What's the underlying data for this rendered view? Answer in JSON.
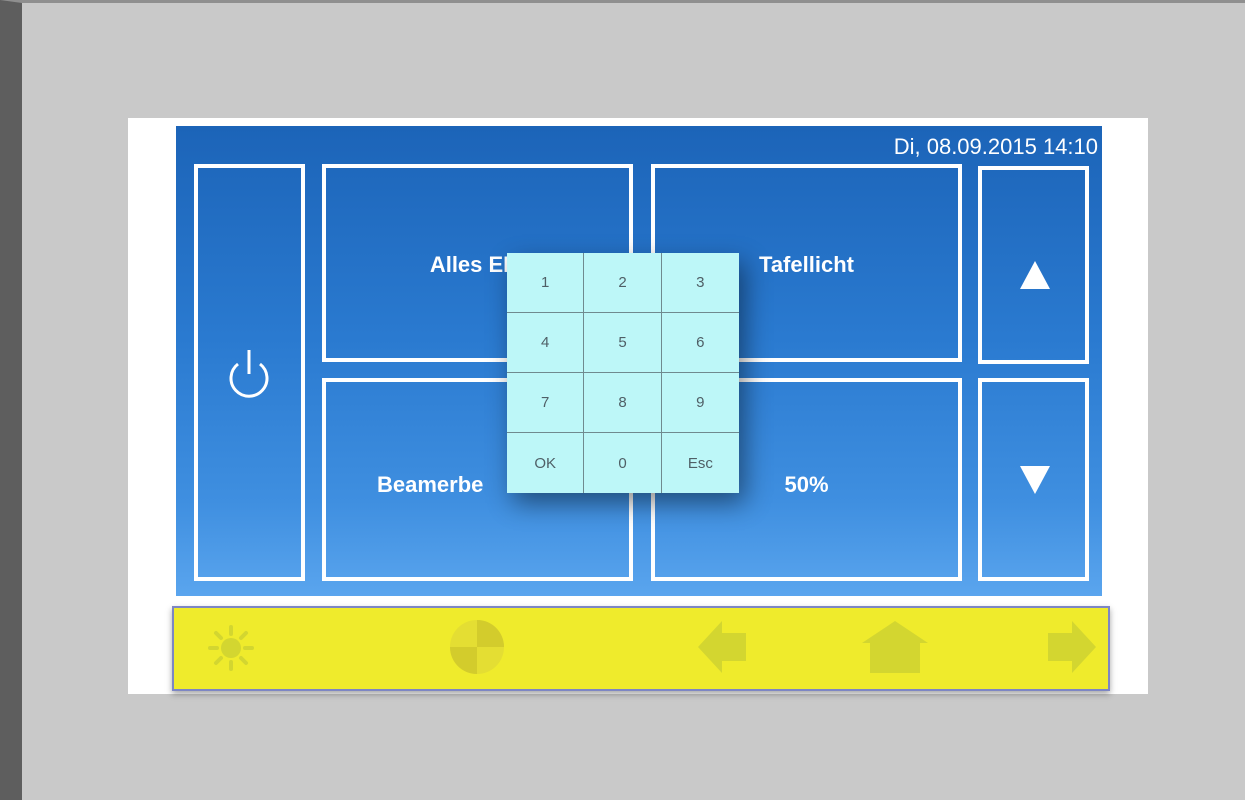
{
  "header": {
    "datetime": "Di, 08.09.2015 14:10"
  },
  "tiles": {
    "power": {
      "icon": "power-icon"
    },
    "alles_ein": {
      "label": "Alles EIN"
    },
    "tafellicht": {
      "label": "Tafellicht"
    },
    "beamer": {
      "label": "Beamerbe"
    },
    "percent": {
      "label": "50%"
    },
    "up": {
      "icon": "arrow-up-icon"
    },
    "down": {
      "icon": "arrow-down-icon"
    }
  },
  "keypad": {
    "keys": [
      "1",
      "2",
      "3",
      "4",
      "5",
      "6",
      "7",
      "8",
      "9",
      "OK",
      "0",
      "Esc"
    ]
  },
  "bottom_bar": {
    "icons": [
      "sun-icon",
      "contrast-icon",
      "arrow-left-icon",
      "home-icon",
      "arrow-right-icon"
    ]
  },
  "colors": {
    "screen_top": "#1c64b8",
    "screen_bottom": "#5aa5ee",
    "bottom_bar": "#efeb2c",
    "bottom_icons": "#d3d630",
    "keypad": "#bdf7f8",
    "tile_border": "#ffffff"
  }
}
